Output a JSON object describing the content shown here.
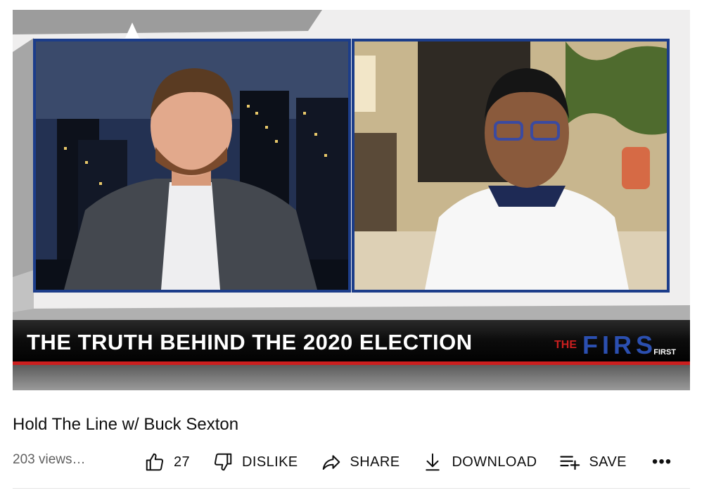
{
  "video": {
    "lower_third_headline": "THE TRUTH BEHIND THE 2020 ELECTION",
    "channel_logo": "THE FIRST",
    "channel_logo_small": "FIRST"
  },
  "title": "Hold The Line w/ Buck Sexton",
  "views": "203 views…",
  "actions": {
    "like_count": "27",
    "dislike_label": "DISLIKE",
    "share_label": "SHARE",
    "download_label": "DOWNLOAD",
    "save_label": "SAVE",
    "more_label": "•••"
  },
  "icons": {
    "like": "thumbs-up-icon",
    "dislike": "thumbs-down-icon",
    "share": "share-arrow-icon",
    "download": "download-icon",
    "save": "playlist-add-icon",
    "more": "more-horizontal-icon"
  },
  "colors": {
    "panel_border": "#1c3d8a",
    "lower_third_red": "#cc1f1f",
    "text_primary": "#0f0f0f",
    "text_secondary": "#606060"
  }
}
